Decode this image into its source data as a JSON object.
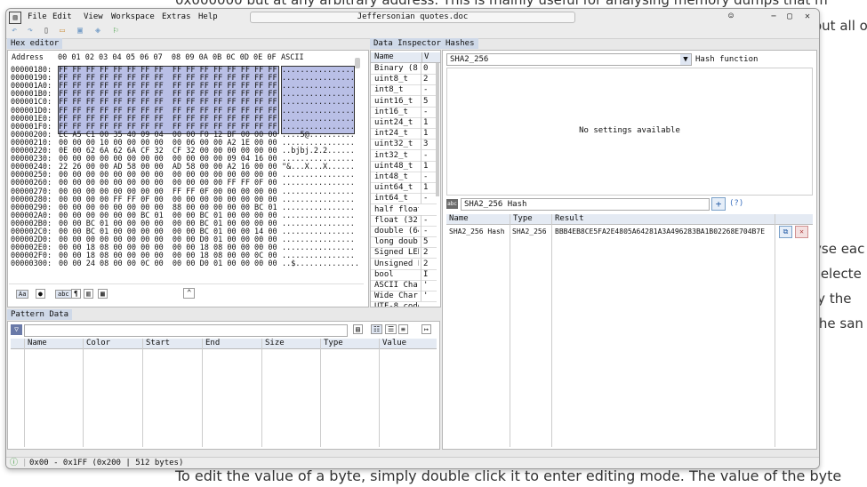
{
  "background": {
    "top_text": "0x000000 but at any arbitrary address. This is mainly useful for analysing memory dumps that m",
    "right_fragments": [
      "out all o",
      "yse eac",
      "selecte",
      "ly the",
      "the san"
    ],
    "close_glyph": "×",
    "bottom_text": "To edit the value of a byte, simply double click it to enter editing mode. The value of the byte"
  },
  "window": {
    "menu": [
      "File",
      "Edit",
      "View",
      "Workspace",
      "Extras",
      "Help"
    ],
    "document_title": "Jeffersonian quotes.doc",
    "controls": {
      "minimize": "−",
      "maximize": "▢",
      "close": "✕"
    }
  },
  "hex_editor": {
    "tab": "Hex editor",
    "header_label": "Address",
    "columns": "00 01 02 03 04 05 06 07  08 09 0A 0B 0C 0D 0E 0F",
    "ascii_label": "ASCII",
    "rows": [
      {
        "addr": "00000180:",
        "bytes": "FF FF FF FF FF FF FF FF  FF FF FF FF FF FF FF FF",
        "ascii": "................"
      },
      {
        "addr": "00000190:",
        "bytes": "FF FF FF FF FF FF FF FF  FF FF FF FF FF FF FF FF",
        "ascii": "................"
      },
      {
        "addr": "000001A0:",
        "bytes": "FF FF FF FF FF FF FF FF  FF FF FF FF FF FF FF FF",
        "ascii": "................"
      },
      {
        "addr": "000001B0:",
        "bytes": "FF FF FF FF FF FF FF FF  FF FF FF FF FF FF FF FF",
        "ascii": "................"
      },
      {
        "addr": "000001C0:",
        "bytes": "FF FF FF FF FF FF FF FF  FF FF FF FF FF FF FF FF",
        "ascii": "................"
      },
      {
        "addr": "000001D0:",
        "bytes": "FF FF FF FF FF FF FF FF  FF FF FF FF FF FF FF FF",
        "ascii": "................"
      },
      {
        "addr": "000001E0:",
        "bytes": "FF FF FF FF FF FF FF FF  FF FF FF FF FF FF FF FF",
        "ascii": "................"
      },
      {
        "addr": "000001F0:",
        "bytes": "FF FF FF FF FF FF FF FF  FF FF FF FF FF FF FF FF",
        "ascii": "................"
      },
      {
        "addr": "00000200:",
        "bytes": "EC A5 C1 00 35 40 09 04  00 00 F0 12 BF 00 00 00",
        "ascii": "....5@.........."
      },
      {
        "addr": "00000210:",
        "bytes": "00 00 00 10 00 00 00 00  00 06 00 00 A2 1E 00 00",
        "ascii": "................"
      },
      {
        "addr": "00000220:",
        "bytes": "0E 00 62 6A 62 6A CF 32  CF 32 00 00 00 00 00 00",
        "ascii": "..bjbj.2.2......"
      },
      {
        "addr": "00000230:",
        "bytes": "00 00 00 00 00 00 00 00  00 00 00 00 09 04 16 00",
        "ascii": "................"
      },
      {
        "addr": "00000240:",
        "bytes": "22 26 00 00 AD 58 00 00  AD 58 00 00 A2 16 00 00",
        "ascii": "\"&...X...X......"
      },
      {
        "addr": "00000250:",
        "bytes": "00 00 00 00 00 00 00 00  00 00 00 00 00 00 00 00",
        "ascii": "................"
      },
      {
        "addr": "00000260:",
        "bytes": "00 00 00 00 00 00 00 00  00 00 00 00 FF FF 0F 00",
        "ascii": "................"
      },
      {
        "addr": "00000270:",
        "bytes": "00 00 00 00 00 00 00 00  FF FF 0F 00 00 00 00 00",
        "ascii": "................"
      },
      {
        "addr": "00000280:",
        "bytes": "00 00 00 00 FF FF 0F 00  00 00 00 00 00 00 00 00",
        "ascii": "................"
      },
      {
        "addr": "00000290:",
        "bytes": "00 00 00 00 00 00 00 00  88 00 00 00 00 00 BC 01",
        "ascii": "................"
      },
      {
        "addr": "000002A0:",
        "bytes": "00 00 00 00 00 00 BC 01  00 00 BC 01 00 00 00 00",
        "ascii": "................"
      },
      {
        "addr": "000002B0:",
        "bytes": "00 00 BC 01 00 00 00 00  00 00 BC 01 00 00 00 00",
        "ascii": "................"
      },
      {
        "addr": "000002C0:",
        "bytes": "00 00 BC 01 00 00 00 00  00 00 BC 01 00 00 14 00",
        "ascii": "................"
      },
      {
        "addr": "000002D0:",
        "bytes": "00 00 00 00 00 00 00 00  00 00 D0 01 00 00 00 00",
        "ascii": "................"
      },
      {
        "addr": "000002E0:",
        "bytes": "00 00 18 08 00 00 00 00  00 00 18 08 00 00 00 00",
        "ascii": "................"
      },
      {
        "addr": "000002F0:",
        "bytes": "00 00 18 08 00 00 00 00  00 00 18 08 00 00 0C 00",
        "ascii": "................"
      },
      {
        "addr": "00000300:",
        "bytes": "00 00 24 08 00 00 0C 00  00 00 D0 01 00 00 00 00",
        "ascii": "..$.............."
      }
    ],
    "footer_icons": [
      "font-icon",
      "pin-icon",
      "abc-icon",
      "pilcrow-icon",
      "columns-icon",
      "grid-icon"
    ],
    "collapse_glyph": "⌃"
  },
  "data_inspector": {
    "tab": "Data Inspector",
    "col_name": "Name",
    "col_value": "V",
    "rows": [
      {
        "name": "Binary (8",
        "value": "0"
      },
      {
        "name": "uint8_t",
        "value": "2"
      },
      {
        "name": "int8_t",
        "value": "-"
      },
      {
        "name": "uint16_t",
        "value": "5"
      },
      {
        "name": "int16_t",
        "value": "-"
      },
      {
        "name": "uint24_t",
        "value": "1"
      },
      {
        "name": "int24_t",
        "value": "1"
      },
      {
        "name": "uint32_t",
        "value": "3"
      },
      {
        "name": "int32_t",
        "value": "-"
      },
      {
        "name": "uint48_t",
        "value": "1"
      },
      {
        "name": "int48_t",
        "value": "-"
      },
      {
        "name": "uint64_t",
        "value": "1"
      },
      {
        "name": "int64_t",
        "value": "-"
      },
      {
        "name": "half float",
        "value": ""
      },
      {
        "name": "float (32",
        "value": "-"
      },
      {
        "name": "double (64",
        "value": "-"
      },
      {
        "name": "long doub",
        "value": "5"
      },
      {
        "name": "Signed LEB",
        "value": "2"
      },
      {
        "name": "Unsigned L",
        "value": "2"
      },
      {
        "name": "bool",
        "value": "I"
      },
      {
        "name": "ASCII Char",
        "value": "'"
      },
      {
        "name": "Wide Char",
        "value": "'"
      },
      {
        "name": "UTF-8 code",
        "value": ""
      }
    ]
  },
  "hashes": {
    "tab": "Hashes",
    "function_selected": "SHA2_256",
    "function_label": "Hash function",
    "settings_message": "No settings available",
    "name_input": "SHA2_256 Hash",
    "add_glyph": "+",
    "help_link": "(?)",
    "col_name": "Name",
    "col_type": "Type",
    "col_result": "Result",
    "rows": [
      {
        "name": "SHA2_256 Hash",
        "type": "SHA2_256",
        "result": "BBB4EB8CE5FA2E4805A64281A3A496283BA1B02268E704B7E"
      }
    ]
  },
  "pattern_data": {
    "tab": "Pattern Data",
    "columns": [
      "Name",
      "Color",
      "Start",
      "End",
      "Size",
      "Type",
      "Value"
    ]
  },
  "status": {
    "text": "0x00 - 0x1FF (0x200 | 512 bytes)"
  }
}
